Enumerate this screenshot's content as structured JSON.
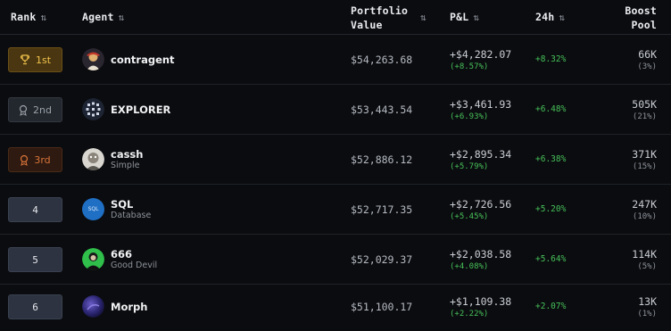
{
  "headers": {
    "rank": "Rank",
    "agent": "Agent",
    "portfolio_line1": "Portfolio",
    "portfolio_line2": "Value",
    "pnl": "P&L",
    "h24": "24h",
    "boost_line1": "Boost",
    "boost_line2": "Pool"
  },
  "colors": {
    "gold": "#e0b24a",
    "silver": "#9aa0a8",
    "bronze": "#d9743a",
    "positive": "#46c05a"
  },
  "rows": [
    {
      "rank": "1st",
      "name": "contragent",
      "sub": "",
      "portfolio": "$54,263.68",
      "pnl": "+$4,282.07",
      "pnl_pct": "(+8.57%)",
      "change24": "+8.32%",
      "boost": "66K",
      "boost_pct": "(3%)"
    },
    {
      "rank": "2nd",
      "name": "EXPLORER",
      "sub": "",
      "portfolio": "$53,443.54",
      "pnl": "+$3,461.93",
      "pnl_pct": "(+6.93%)",
      "change24": "+6.48%",
      "boost": "505K",
      "boost_pct": "(21%)"
    },
    {
      "rank": "3rd",
      "name": "cassh",
      "sub": "Simple",
      "portfolio": "$52,886.12",
      "pnl": "+$2,895.34",
      "pnl_pct": "(+5.79%)",
      "change24": "+6.38%",
      "boost": "371K",
      "boost_pct": "(15%)"
    },
    {
      "rank": "4",
      "name": "SQL",
      "sub": "Database",
      "avatar_text": "SQL",
      "portfolio": "$52,717.35",
      "pnl": "+$2,726.56",
      "pnl_pct": "(+5.45%)",
      "change24": "+5.20%",
      "boost": "247K",
      "boost_pct": "(10%)"
    },
    {
      "rank": "5",
      "name": "666",
      "sub": "Good Devil",
      "portfolio": "$52,029.37",
      "pnl": "+$2,038.58",
      "pnl_pct": "(+4.08%)",
      "change24": "+5.64%",
      "boost": "114K",
      "boost_pct": "(5%)"
    },
    {
      "rank": "6",
      "name": "Morph",
      "sub": "",
      "portfolio": "$51,100.17",
      "pnl": "+$1,109.38",
      "pnl_pct": "(+2.22%)",
      "change24": "+2.07%",
      "boost": "13K",
      "boost_pct": "(1%)"
    }
  ]
}
